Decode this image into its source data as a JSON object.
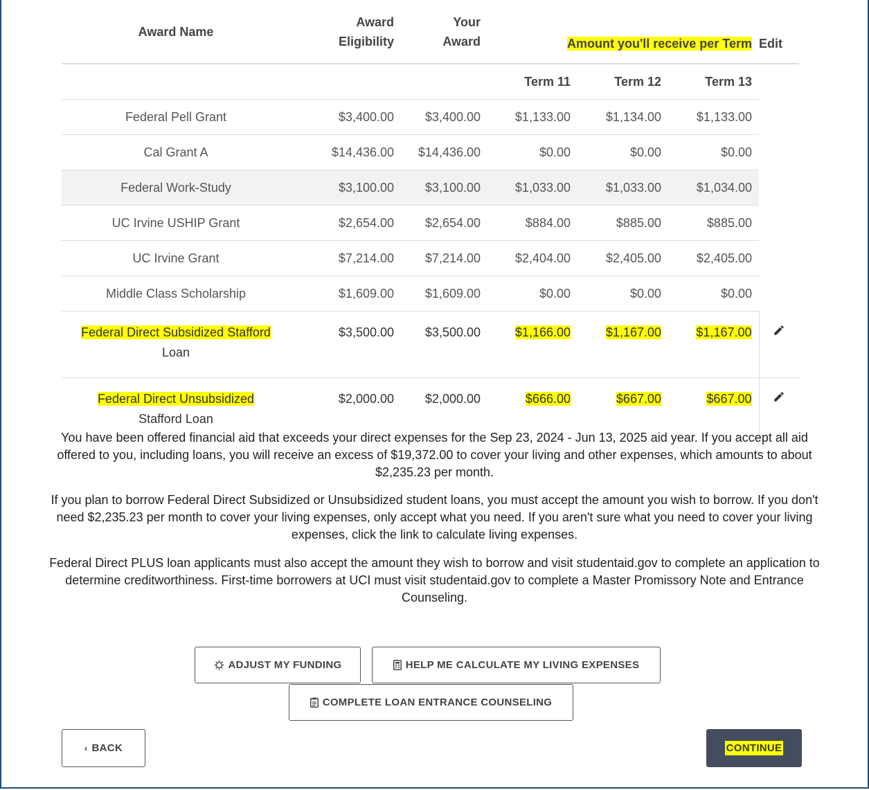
{
  "table": {
    "headers": {
      "award_name": "Award Name",
      "eligibility_line1": "Award",
      "eligibility_line2": "Eligibility",
      "your_award_line1": "Your",
      "your_award_line2": "Award",
      "per_term": "Amount you'll receive per Term",
      "edit": "Edit"
    },
    "terms": [
      "Term 11",
      "Term 12",
      "Term 13"
    ],
    "rows": [
      {
        "name": "Federal Pell Grant",
        "eligibility": "$3,400.00",
        "award": "$3,400.00",
        "t11": "$1,133.00",
        "t12": "$1,134.00",
        "t13": "$1,133.00"
      },
      {
        "name": "Cal Grant A",
        "eligibility": "$14,436.00",
        "award": "$14,436.00",
        "t11": "$0.00",
        "t12": "$0.00",
        "t13": "$0.00"
      },
      {
        "name": "Federal Work-Study",
        "eligibility": "$3,100.00",
        "award": "$3,100.00",
        "t11": "$1,033.00",
        "t12": "$1,033.00",
        "t13": "$1,034.00"
      },
      {
        "name": "UC Irvine USHIP Grant",
        "eligibility": "$2,654.00",
        "award": "$2,654.00",
        "t11": "$884.00",
        "t12": "$885.00",
        "t13": "$885.00"
      },
      {
        "name": "UC Irvine Grant",
        "eligibility": "$7,214.00",
        "award": "$7,214.00",
        "t11": "$2,404.00",
        "t12": "$2,405.00",
        "t13": "$2,405.00"
      },
      {
        "name": "Middle Class Scholarship",
        "eligibility": "$1,609.00",
        "award": "$1,609.00",
        "t11": "$0.00",
        "t12": "$0.00",
        "t13": "$0.00"
      },
      {
        "name_line1": "Federal Direct Subsidized Stafford",
        "name_line2": "Loan",
        "eligibility": "$3,500.00",
        "award": "$3,500.00",
        "t11": "$1,166.00",
        "t12": "$1,167.00",
        "t13": "$1,167.00",
        "edit_icon": "pencil-icon"
      },
      {
        "name_line1": "Federal Direct Unsubsidized",
        "name_line2": "Stafford Loan",
        "eligibility": "$2,000.00",
        "award": "$2,000.00",
        "t11": "$666.00",
        "t12": "$667.00",
        "t13": "$667.00",
        "edit_icon": "pencil-icon"
      }
    ]
  },
  "info": {
    "p1": "You have been offered financial aid that exceeds your direct expenses for the Sep 23, 2024 - Jun 13, 2025 aid year. If you accept all aid offered to you, including loans, you will receive an excess of $19,372.00 to cover your living and other expenses, which amounts to about $2,235.23 per month.",
    "p2": "If you plan to borrow Federal Direct Subsidized or Unsubsidized student loans, you must accept the amount you wish to borrow. If you don't need $2,235.23 per month to cover your living expenses, only accept what you need. If you aren't sure what you need to cover your living expenses, click the link to calculate living expenses.",
    "p3": "Federal Direct PLUS loan applicants must also accept the amount they wish to borrow and visit studentaid.gov to complete an application to determine creditworthiness. First-time borrowers at UCI must visit studentaid.gov to complete a Master Promissory Note and Entrance Counseling."
  },
  "buttons": {
    "adjust": "ADJUST MY FUNDING",
    "living": "HELP ME CALCULATE MY LIVING EXPENSES",
    "counseling": "COMPLETE LOAN ENTRANCE COUNSELING",
    "back": "BACK",
    "continue": "CONTINUE"
  },
  "colors": {
    "highlight": "#ffff00",
    "continue_bg": "#434d5e",
    "frame_border": "#1f4e79"
  }
}
